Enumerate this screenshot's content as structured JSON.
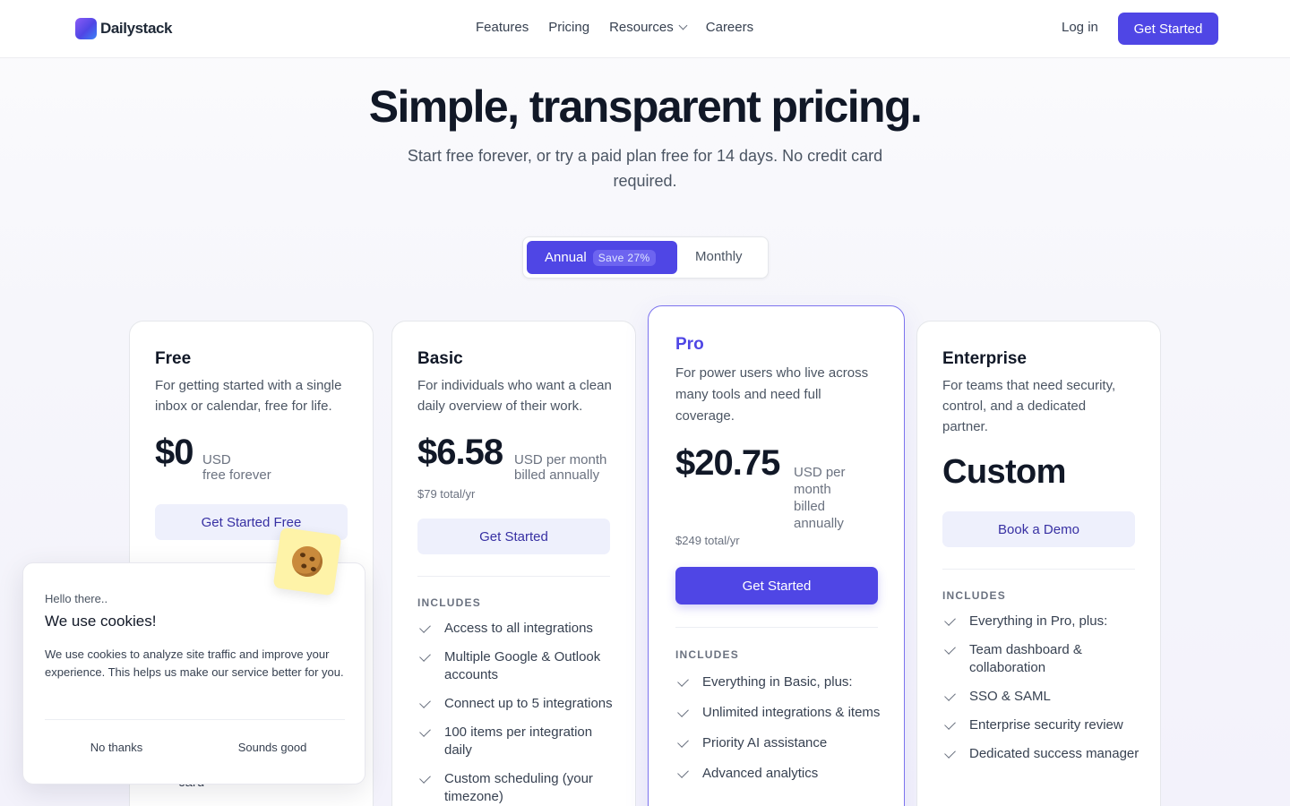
{
  "nav": {
    "brand": "Dailystack",
    "links": [
      "Features",
      "Pricing",
      "Resources",
      "Careers"
    ],
    "login": "Log in",
    "cta": "Get Started"
  },
  "hero": {
    "title": "Simple, transparent pricing.",
    "subtitle": "Start free forever, or try a paid plan free for 14 days. No credit card required."
  },
  "billing_toggle": {
    "annual": "Annual",
    "save_badge": "Save 27%",
    "monthly": "Monthly",
    "selected": "Annual"
  },
  "plans": {
    "free": {
      "name": "Free",
      "description": "For getting started with a single inbox or calendar, free for life.",
      "price": "$0",
      "price_unit": "USD",
      "price_period": "free forever",
      "cta": "Get Started Free",
      "partial_feature": "card"
    },
    "basic": {
      "name": "Basic",
      "description": "For individuals who want a clean daily overview of their work.",
      "price": "$6.58",
      "price_unit": "USD per month",
      "price_period": "billed annually",
      "total": "$79 total/yr",
      "cta": "Get Started",
      "includes_label": "INCLUDES",
      "features": [
        "Access to all integrations",
        "Multiple Google & Outlook accounts",
        "Connect up to 5 integrations",
        "100 items per integration daily",
        "Custom scheduling (your timezone)"
      ]
    },
    "pro": {
      "name": "Pro",
      "description": "For power users who live across many tools and need full coverage.",
      "price": "$20.75",
      "price_note": "USD per month billed annually",
      "total": "$249 total/yr",
      "cta": "Get Started",
      "includes_label": "INCLUDES",
      "features": [
        "Everything in Basic, plus:",
        "Unlimited integrations & items",
        "Priority AI assistance",
        "Advanced analytics"
      ]
    },
    "enterprise": {
      "name": "Enterprise",
      "description": "For teams that need security, control, and a dedicated partner.",
      "price": "Custom",
      "cta": "Book a Demo",
      "includes_label": "INCLUDES",
      "features": [
        "Everything in Pro, plus:",
        "Team dashboard & collaboration",
        "SSO & SAML",
        "Enterprise security review",
        "Dedicated success manager"
      ]
    }
  },
  "cookie_banner": {
    "greeting": "Hello there..",
    "title": "We use cookies!",
    "body": "We use cookies to analyze site traffic and improve your experience. This helps us make our service better for you.",
    "decline": "No thanks",
    "accept": "Sounds good",
    "icon": "cookie-icon"
  },
  "colors": {
    "accent": "#4f46e5",
    "accent_soft": "#eef0fc",
    "text": "#111827",
    "muted": "#6b7280"
  }
}
